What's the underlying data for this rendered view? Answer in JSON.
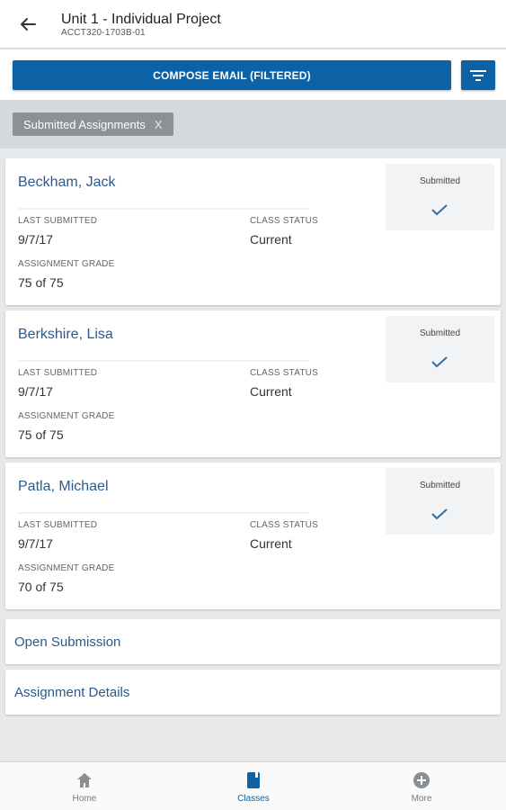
{
  "header": {
    "title": "Unit 1 - Individual Project",
    "subtitle": "ACCT320-1703B-01"
  },
  "toolbar": {
    "compose_label": "COMPOSE EMAIL (FILTERED)"
  },
  "filter_chip": {
    "label": "Submitted Assignments",
    "close": "X"
  },
  "labels": {
    "last_submitted": "LAST SUBMITTED",
    "class_status": "CLASS STATUS",
    "assignment_grade": "ASSIGNMENT GRADE"
  },
  "students": [
    {
      "name": "Beckham, Jack",
      "last_submitted": "9/7/17",
      "class_status": "Current",
      "grade": "75 of 75",
      "status": "Submitted"
    },
    {
      "name": "Berkshire, Lisa",
      "last_submitted": "9/7/17",
      "class_status": "Current",
      "grade": "75 of 75",
      "status": "Submitted"
    },
    {
      "name": "Patla, Michael",
      "last_submitted": "9/7/17",
      "class_status": "Current",
      "grade": "70 of 75",
      "status": "Submitted"
    }
  ],
  "links": {
    "open_submission": "Open Submission",
    "assignment_details": "Assignment Details"
  },
  "nav": {
    "home": "Home",
    "classes": "Classes",
    "more": "More"
  },
  "colors": {
    "accent": "#0c62a4",
    "link": "#2c5a8a",
    "chip": "#8a9197"
  },
  "icons": [
    "back-arrow-icon",
    "filter-icon",
    "check-icon",
    "home-icon",
    "classes-icon",
    "more-icon"
  ]
}
